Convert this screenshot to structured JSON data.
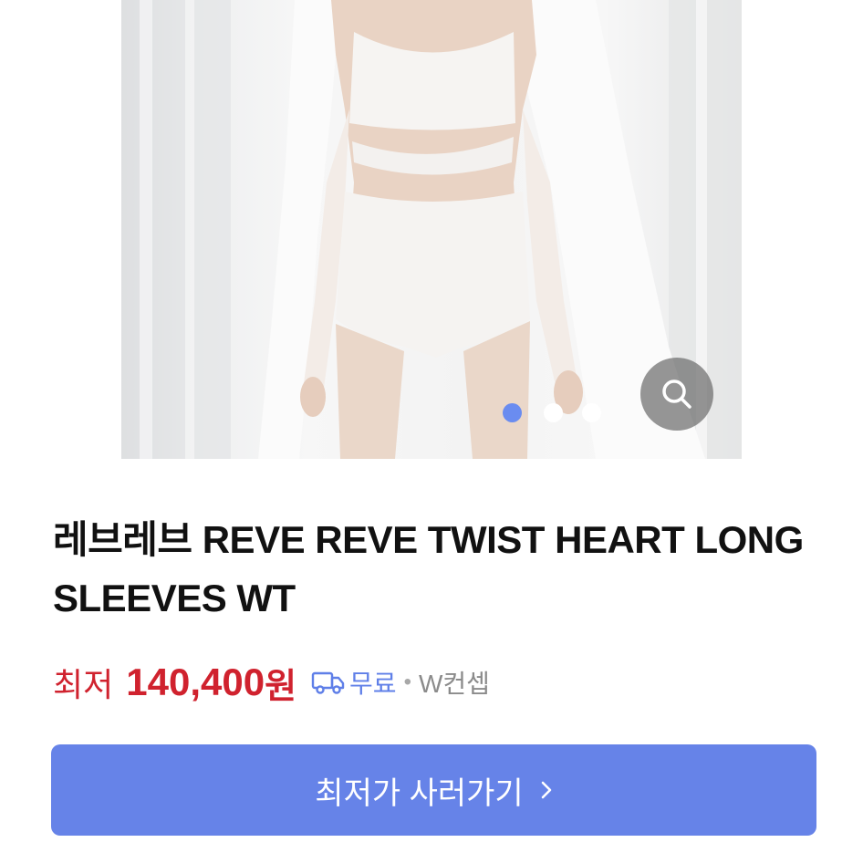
{
  "product": {
    "title": "레브레브 REVE REVE TWIST HEART LONG SLEEVES WT",
    "price_prefix": "최저",
    "price_value": "140,400",
    "price_unit": "원",
    "shipping_label": "무료",
    "separator": "•",
    "seller": "W컨셉"
  },
  "gallery": {
    "slide_count": 3,
    "active_index": 0,
    "icons": [
      "search-icon"
    ]
  },
  "cta": {
    "label": "최저가 사러가기",
    "icon": "chevron-right-icon"
  },
  "colors": {
    "price": "#d0222e",
    "accent": "#6683e8",
    "dot_active": "#6a8cf0"
  }
}
